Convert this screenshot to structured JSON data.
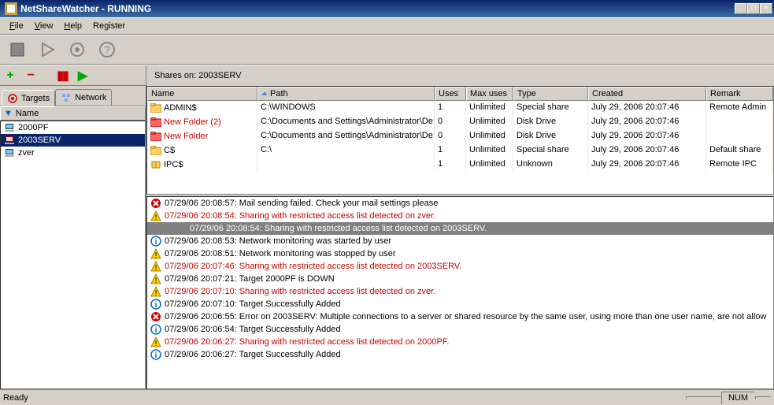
{
  "window": {
    "title": "NetShareWatcher - RUNNING"
  },
  "menu": {
    "file": "File",
    "view": "View",
    "help": "Help",
    "register": "Register"
  },
  "tabs": {
    "targets": "Targets",
    "network": "Network"
  },
  "tree": {
    "header": "Name",
    "items": [
      {
        "name": "2000PF",
        "selected": false
      },
      {
        "name": "2003SERV",
        "selected": true
      },
      {
        "name": "zver",
        "selected": false
      }
    ]
  },
  "sharesHeader": "Shares on: 2003SERV",
  "columns": {
    "name": "Name",
    "path": "Path",
    "uses": "Uses",
    "max": "Max uses",
    "type": "Type",
    "created": "Created",
    "remark": "Remark"
  },
  "rows": [
    {
      "icon": "folder",
      "red": false,
      "name": "ADMIN$",
      "path": "C:\\WINDOWS",
      "uses": "1",
      "max": "Unlimited",
      "type": "Special share",
      "created": "July 29, 2006 20:07:46",
      "remark": "Remote Admin"
    },
    {
      "icon": "folder",
      "red": true,
      "name": "New Folder (2)",
      "path": "C:\\Documents and Settings\\Administrator\\De:",
      "uses": "0",
      "max": "Unlimited",
      "type": "Disk Drive",
      "created": "July 29, 2006 20:07:46",
      "remark": ""
    },
    {
      "icon": "folder",
      "red": true,
      "name": "New Folder",
      "path": "C:\\Documents and Settings\\Administrator\\De:",
      "uses": "0",
      "max": "Unlimited",
      "type": "Disk Drive",
      "created": "July 29, 2006 20:07:46",
      "remark": ""
    },
    {
      "icon": "folder",
      "red": false,
      "name": "C$",
      "path": "C:\\",
      "uses": "1",
      "max": "Unlimited",
      "type": "Special share",
      "created": "July 29, 2006 20:07:46",
      "remark": "Default share"
    },
    {
      "icon": "ipc",
      "red": false,
      "name": "IPC$",
      "path": "",
      "uses": "1",
      "max": "Unlimited",
      "type": "Unknown",
      "created": "July 29, 2006 20:07:46",
      "remark": "Remote IPC"
    }
  ],
  "log": [
    {
      "icon": "error",
      "red": false,
      "sel": false,
      "text": "07/29/06 20:08:57: Mail sending failed. Check your mail settings please"
    },
    {
      "icon": "warn",
      "red": true,
      "sel": false,
      "text": "07/29/06 20:08:54: Sharing with restricted access list detected on zver."
    },
    {
      "icon": "",
      "red": false,
      "sel": true,
      "text": "07/29/06 20:08:54: Sharing with restricted access list detected on 2003SERV."
    },
    {
      "icon": "info",
      "red": false,
      "sel": false,
      "text": "07/29/06 20:08:53: Network monitoring was started by user"
    },
    {
      "icon": "warn",
      "red": false,
      "sel": false,
      "text": "07/29/06 20:08:51: Network monitoring was stopped by user"
    },
    {
      "icon": "warn",
      "red": true,
      "sel": false,
      "text": "07/29/06 20:07:46: Sharing with restricted access list detected on 2003SERV."
    },
    {
      "icon": "warn",
      "red": false,
      "sel": false,
      "text": "07/29/06 20:07:21: Target 2000PF is DOWN"
    },
    {
      "icon": "warn",
      "red": true,
      "sel": false,
      "text": "07/29/06 20:07:10: Sharing with restricted access list detected on zver."
    },
    {
      "icon": "info",
      "red": false,
      "sel": false,
      "text": "07/29/06 20:07:10: Target Successfully Added"
    },
    {
      "icon": "error",
      "red": false,
      "sel": false,
      "text": "07/29/06 20:06:55: Error on 2003SERV: Multiple connections to a server or shared resource by the same user, using more than one user name, are not allow"
    },
    {
      "icon": "info",
      "red": false,
      "sel": false,
      "text": "07/29/06 20:06:54: Target Successfully Added"
    },
    {
      "icon": "warn",
      "red": true,
      "sel": false,
      "text": "07/29/06 20:06:27: Sharing with restricted access list detected on 2000PF."
    },
    {
      "icon": "info",
      "red": false,
      "sel": false,
      "text": "07/29/06 20:06:27: Target Successfully Added"
    }
  ],
  "status": {
    "ready": "Ready",
    "num": "NUM"
  }
}
